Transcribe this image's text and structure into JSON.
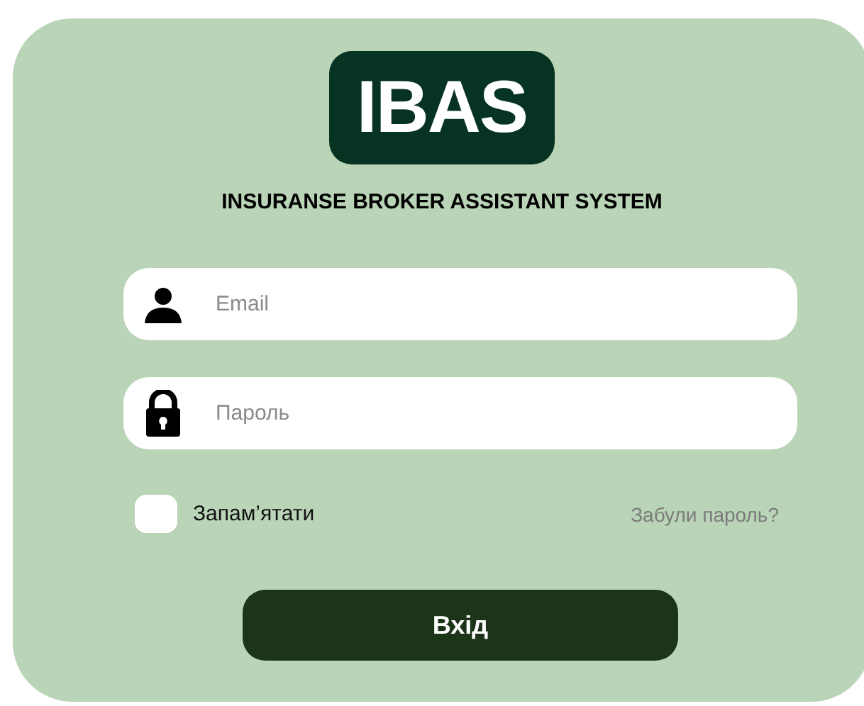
{
  "logo": {
    "text": "IBAS"
  },
  "subtitle": "INSURANSE BROKER ASSISTANT SYSTEM",
  "fields": [
    {
      "kind": "user",
      "placeholder": "Email"
    },
    {
      "kind": "lock",
      "placeholder": "Пароль"
    }
  ],
  "remember": {
    "label": "Запам’ятати",
    "checked": false
  },
  "forgot_link": "Забули пароль?",
  "login_button": "Вхід"
}
